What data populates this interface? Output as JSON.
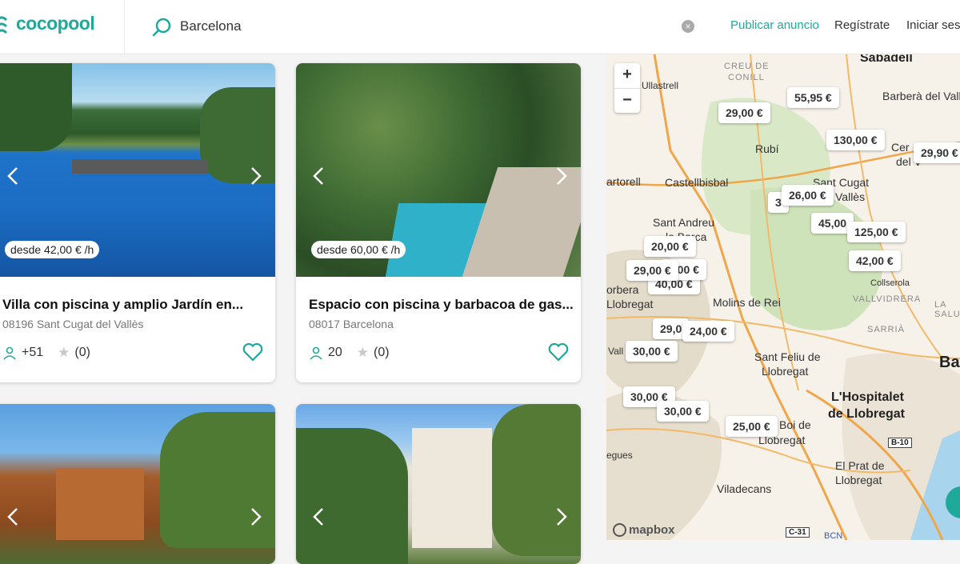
{
  "header": {
    "logo": "cocopool",
    "search": {
      "value": "Barcelona"
    },
    "nav": {
      "publish": "Publicar anuncio",
      "register": "Regístrate",
      "login": "Iniciar sesi"
    }
  },
  "listings": [
    {
      "price": "desde 42,00 € /h",
      "title": "Villa con piscina y amplio Jardín en...",
      "location": "08196 Sant Cugat del Vallès",
      "guests": "+51",
      "rating": "(0)"
    },
    {
      "price": "desde 60,00 € /h",
      "title": "Espacio con piscina y barbacoa de gas...",
      "location": "08017 Barcelona",
      "guests": "20",
      "rating": "(0)"
    },
    {
      "price": "",
      "title": "",
      "location": "",
      "guests": "",
      "rating": ""
    },
    {
      "price": "",
      "title": "",
      "location": "",
      "guests": "",
      "rating": ""
    }
  ],
  "map": {
    "zoom_in": "+",
    "zoom_out": "−",
    "places": {
      "sabadell": "Sabadell",
      "barbera": "Barberà del Vallès",
      "creu": "CREU DE",
      "conill": "CONILL",
      "ullastrell": "Ullastrell",
      "rubi": "Rubí",
      "cerdanyola_1": "Cer",
      "cerdanyola_2": "del V",
      "martorell": "artorell",
      "castellbisbal": "Castellbisbal",
      "santcugat_1": "Sant Cugat",
      "santcugat_2": "Vallès",
      "santandreu_1": "Sant Andreu",
      "santandreu_2": "la Barca",
      "corbera": "orbera",
      "llobregat": "Llobregat",
      "molins": "Molins de Rei",
      "vallvidrera": "VALLVIDRERA",
      "lasalut": "LA SALU",
      "sarria": "SARRIÀ",
      "vall": "Vall",
      "barcelona": "Ba",
      "santfeliu_1": "Sant Feliu de",
      "santfeliu_2": "Llobregat",
      "hospitalet_1": "L'Hospitalet",
      "hospitalet_2": "de Llobregat",
      "boi_1": "Boi de",
      "boi_2": "Llobregat",
      "elprat_1": "El Prat de",
      "elprat_2": "Llobregat",
      "viladecans": "Viladecans",
      "begues": "egues",
      "collserola": "Collserola",
      "b10": "B-10",
      "c31": "C-31",
      "bcn": "BCN"
    },
    "markers": [
      "29,00 €",
      "55,95 €",
      "130,00 €",
      "29,90 €",
      "26,00 €",
      "3",
      "45,00",
      "125,00 €",
      "20,00 €",
      "42,00 €",
      "29,00 €",
      "0,00 €",
      "40,00 €",
      "29,0",
      "24,00 €",
      "30,00 €",
      "30,00 €",
      "30,00 €",
      "25,00 €"
    ],
    "attribution": "mapbox"
  }
}
